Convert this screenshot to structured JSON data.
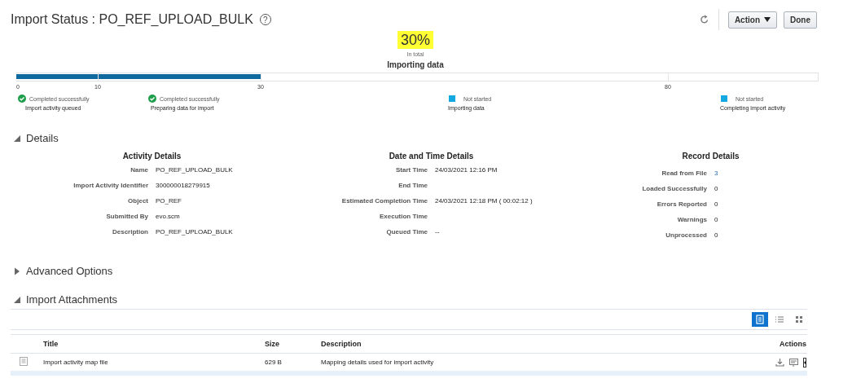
{
  "page": {
    "title": "Import Status : PO_REF_UPLOAD_BULK",
    "help_glyph": "?",
    "buttons": [
      {
        "label": "Action",
        "kind": "menu"
      },
      {
        "label": "Done",
        "kind": "plain"
      }
    ]
  },
  "progress": {
    "percent": "30%",
    "caption": "In total",
    "phase": "Importing data",
    "level": 0.3,
    "ticks": [
      "0",
      "10",
      "30",
      "80"
    ],
    "stages": [
      {
        "status": "Completed successfully",
        "name": "Import activity queued",
        "kind": "completed"
      },
      {
        "status": "Completed successfully",
        "name": "Preparing data for import",
        "kind": "completed"
      },
      {
        "status": "Not started",
        "name": "Importing data",
        "kind": "not_started"
      },
      {
        "status": "Not started",
        "name": "Completing import activity",
        "kind": "not_started"
      }
    ]
  },
  "details": {
    "title": "Details",
    "expanded": true,
    "groups": [
      {
        "heading": "Activity Details",
        "fields": [
          {
            "label": "Name",
            "value": "PO_REF_UPLOAD_BULK",
            "kind": "text"
          },
          {
            "label": "Import Activity Identifier",
            "value": "300000018279915",
            "kind": "text"
          },
          {
            "label": "Object",
            "value": "PO_REF",
            "kind": "text"
          },
          {
            "label": "Submitted By",
            "value": "evo.scm",
            "kind": "text"
          },
          {
            "label": "Description",
            "value": "PO_REF_UPLOAD_BULK",
            "kind": "text"
          }
        ]
      },
      {
        "heading": "Date and Time Details",
        "fields": [
          {
            "label": "Start Time",
            "value": "24/03/2021 12:16 PM",
            "kind": "text"
          },
          {
            "label": "End Time",
            "kind": "text"
          },
          {
            "label": "Estimated Completion Time",
            "value": "24/03/2021 12:18 PM ( 00:02:12 )",
            "kind": "text"
          },
          {
            "label": "Execution Time",
            "kind": "text"
          },
          {
            "label": "Queued Time",
            "value": "--",
            "kind": "text"
          }
        ]
      },
      {
        "heading": "Record Details",
        "fields": [
          {
            "label": "Read from File",
            "value": "3",
            "kind": "link"
          },
          {
            "label": "Loaded Successfully",
            "value": "0",
            "kind": "text"
          },
          {
            "label": "Errors Reported",
            "value": "0",
            "kind": "text"
          },
          {
            "label": "Warnings",
            "value": "0",
            "kind": "text"
          },
          {
            "label": "Unprocessed",
            "value": "0",
            "kind": "text"
          }
        ]
      }
    ]
  },
  "advanced_options": {
    "title": "Advanced Options",
    "expanded": false
  },
  "attachments": {
    "title": "Import Attachments",
    "expanded": true,
    "views": [
      {
        "kind": "table",
        "selected": true
      },
      {
        "kind": "list",
        "selected": false
      },
      {
        "kind": "grid",
        "selected": false
      }
    ],
    "columns": [
      "Title",
      "Size",
      "Description",
      "Actions"
    ],
    "rows": [
      {
        "title": "Import activity map file",
        "size": "629 B",
        "description": "Mapping details used for import activity",
        "selected": false
      }
    ]
  }
}
